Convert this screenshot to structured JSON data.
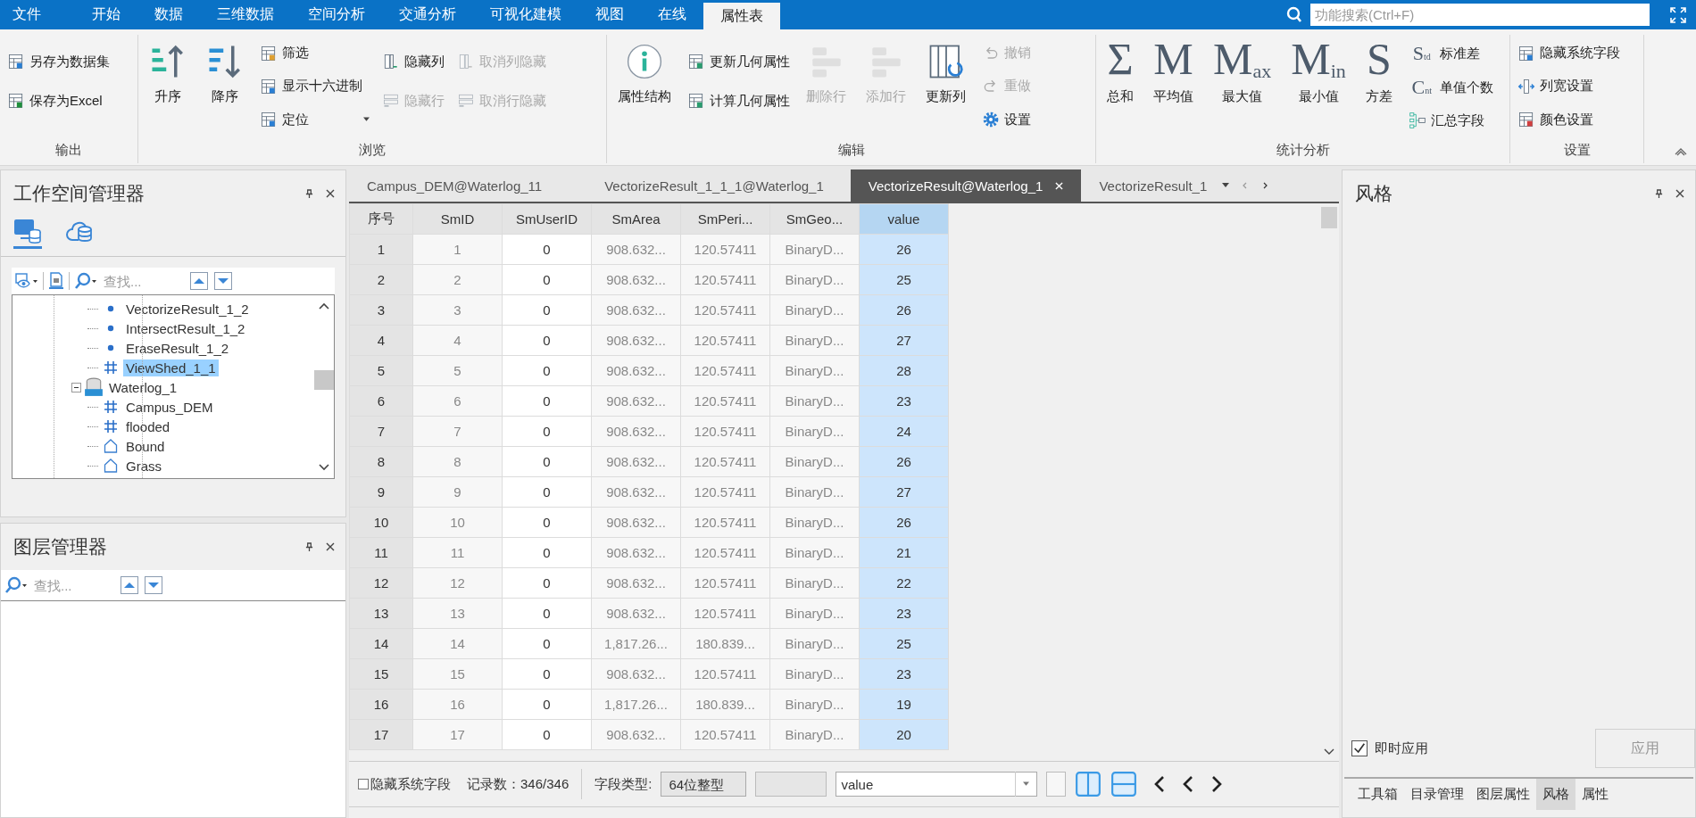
{
  "menu": {
    "tabs": [
      {
        "label": "文件",
        "selected": false
      },
      {
        "label": "开始",
        "selected": false
      },
      {
        "label": "数据",
        "selected": false
      },
      {
        "label": "三维数据",
        "selected": false
      },
      {
        "label": "空间分析",
        "selected": false
      },
      {
        "label": "交通分析",
        "selected": false
      },
      {
        "label": "可视化建模",
        "selected": false
      },
      {
        "label": "视图",
        "selected": false
      },
      {
        "label": "在线",
        "selected": false
      },
      {
        "label": "属性表",
        "selected": true
      }
    ],
    "search": {
      "placeholder": "功能搜索(Ctrl+F)"
    }
  },
  "ribbon": {
    "groups": [
      {
        "title": "输出",
        "columns": [
          [
            {
              "kind": "small",
              "label": "另存为数据集",
              "disabled": false
            },
            {
              "kind": "small",
              "label": "保存为Excel",
              "disabled": false
            }
          ]
        ]
      },
      {
        "title": "浏览",
        "columns": [
          [
            {
              "kind": "large",
              "label": "升序",
              "disabled": false
            }
          ],
          [
            {
              "kind": "large",
              "label": "降序",
              "disabled": false
            }
          ],
          [
            {
              "kind": "small",
              "label": "筛选",
              "disabled": false
            },
            {
              "kind": "small",
              "label": "显示十六进制",
              "disabled": false
            },
            {
              "kind": "small",
              "label": "定位",
              "disabled": false,
              "dropdown": true
            }
          ],
          [
            {
              "kind": "small",
              "label": "隐藏列",
              "disabled": false
            },
            {
              "kind": "small",
              "label": "隐藏行",
              "disabled": true
            }
          ],
          [
            {
              "kind": "small",
              "label": "取消列隐藏",
              "disabled": true
            },
            {
              "kind": "small",
              "label": "取消行隐藏",
              "disabled": true
            }
          ]
        ]
      },
      {
        "title": "编辑",
        "columns": [
          [
            {
              "kind": "large",
              "label": "属性结构",
              "disabled": false
            }
          ],
          [
            {
              "kind": "small",
              "label": "更新几何属性",
              "disabled": false
            },
            {
              "kind": "small",
              "label": "计算几何属性",
              "disabled": false
            }
          ],
          [
            {
              "kind": "large",
              "label": "删除行",
              "disabled": true
            }
          ],
          [
            {
              "kind": "large",
              "label": "添加行",
              "disabled": true
            }
          ],
          [
            {
              "kind": "large",
              "label": "更新列",
              "disabled": false
            }
          ],
          [
            {
              "kind": "small",
              "label": "撤销",
              "disabled": true
            },
            {
              "kind": "small",
              "label": "重做",
              "disabled": true
            },
            {
              "kind": "small",
              "label": "设置",
              "disabled": false
            }
          ]
        ]
      },
      {
        "title": "统计分析",
        "columns": [
          [
            {
              "kind": "large",
              "label": "总和",
              "glyph": "Σ",
              "disabled": false
            }
          ],
          [
            {
              "kind": "large",
              "label": "平均值",
              "glyph": "M",
              "disabled": false
            }
          ],
          [
            {
              "kind": "large",
              "label": "最大值",
              "glyph": "M",
              "glyph_sub": "ax",
              "disabled": false
            }
          ],
          [
            {
              "kind": "large",
              "label": "最小值",
              "glyph": "M",
              "glyph_sub": "in",
              "disabled": false
            }
          ],
          [
            {
              "kind": "large",
              "label": "方差",
              "glyph": "S",
              "disabled": false
            }
          ],
          [
            {
              "kind": "small",
              "label": "标准差",
              "glyph": "S",
              "glyph_sub": "td",
              "disabled": false
            },
            {
              "kind": "small",
              "label": "单值个数",
              "glyph": "C",
              "glyph_sub": "nt",
              "disabled": false
            },
            {
              "kind": "small",
              "label": "汇总字段",
              "disabled": false
            }
          ]
        ]
      },
      {
        "title": "设置",
        "columns": [
          [
            {
              "kind": "small",
              "label": "隐藏系统字段",
              "disabled": false
            },
            {
              "kind": "small",
              "label": "列宽设置",
              "disabled": false
            },
            {
              "kind": "small",
              "label": "颜色设置",
              "disabled": false
            }
          ]
        ]
      }
    ]
  },
  "workspace_panel": {
    "title": "工作空间管理器",
    "view_tabs": [
      {
        "selected": true
      },
      {
        "selected": false
      }
    ],
    "search": {
      "placeholder": "查找..."
    },
    "tree": [
      {
        "children": [
          {
            "label": "VectorizeResult_1_2",
            "kind": "point",
            "selected": false
          },
          {
            "label": "IntersectResult_1_2",
            "kind": "point",
            "selected": false
          },
          {
            "label": "EraseResult_1_2",
            "kind": "point",
            "selected": false
          },
          {
            "label": "ViewShed_1_1",
            "kind": "grid",
            "selected": true
          }
        ]
      },
      {
        "label": "Waterlog_1",
        "kind": "datasource",
        "expanded": true,
        "children": [
          {
            "label": "Campus_DEM",
            "kind": "grid",
            "selected": false
          },
          {
            "label": "flooded",
            "kind": "grid",
            "selected": false
          },
          {
            "label": "Bound",
            "kind": "region",
            "selected": false
          },
          {
            "label": "Grass",
            "kind": "region",
            "selected": false
          }
        ]
      }
    ]
  },
  "layer_panel": {
    "title": "图层管理器",
    "search": {
      "placeholder": "查找..."
    }
  },
  "document_tabs": [
    {
      "label": "Campus_DEM@Waterlog_11",
      "selected": false
    },
    {
      "label": "VectorizeResult_1_1_1@Waterlog_1",
      "selected": false
    },
    {
      "label": "VectorizeResult@Waterlog_1",
      "selected": true
    },
    {
      "label": "VectorizeResult_1",
      "selected": false
    }
  ],
  "table": {
    "columns": [
      {
        "label": "序号",
        "kind": "index",
        "selected": false,
        "readonly": true
      },
      {
        "label": "SmID",
        "kind": "field",
        "selected": false,
        "readonly": true
      },
      {
        "label": "SmUserID",
        "kind": "field",
        "selected": false,
        "readonly": false
      },
      {
        "label": "SmArea",
        "kind": "field",
        "selected": false,
        "readonly": true
      },
      {
        "label": "SmPeri...",
        "kind": "field",
        "selected": false,
        "readonly": true
      },
      {
        "label": "SmGeo...",
        "kind": "field",
        "selected": false,
        "readonly": true
      },
      {
        "label": "value",
        "kind": "field",
        "selected": true,
        "readonly": false
      }
    ],
    "rows": [
      [
        "1",
        "1",
        "0",
        "908.632...",
        "120.57411",
        "BinaryD...",
        "26"
      ],
      [
        "2",
        "2",
        "0",
        "908.632...",
        "120.57411",
        "BinaryD...",
        "25"
      ],
      [
        "3",
        "3",
        "0",
        "908.632...",
        "120.57411",
        "BinaryD...",
        "26"
      ],
      [
        "4",
        "4",
        "0",
        "908.632...",
        "120.57411",
        "BinaryD...",
        "27"
      ],
      [
        "5",
        "5",
        "0",
        "908.632...",
        "120.57411",
        "BinaryD...",
        "28"
      ],
      [
        "6",
        "6",
        "0",
        "908.632...",
        "120.57411",
        "BinaryD...",
        "23"
      ],
      [
        "7",
        "7",
        "0",
        "908.632...",
        "120.57411",
        "BinaryD...",
        "24"
      ],
      [
        "8",
        "8",
        "0",
        "908.632...",
        "120.57411",
        "BinaryD...",
        "26"
      ],
      [
        "9",
        "9",
        "0",
        "908.632...",
        "120.57411",
        "BinaryD...",
        "27"
      ],
      [
        "10",
        "10",
        "0",
        "908.632...",
        "120.57411",
        "BinaryD...",
        "26"
      ],
      [
        "11",
        "11",
        "0",
        "908.632...",
        "120.57411",
        "BinaryD...",
        "21"
      ],
      [
        "12",
        "12",
        "0",
        "908.632...",
        "120.57411",
        "BinaryD...",
        "22"
      ],
      [
        "13",
        "13",
        "0",
        "908.632...",
        "120.57411",
        "BinaryD...",
        "23"
      ],
      [
        "14",
        "14",
        "0",
        "1,817.26...",
        "180.839...",
        "BinaryD...",
        "25"
      ],
      [
        "15",
        "15",
        "0",
        "908.632...",
        "120.57411",
        "BinaryD...",
        "23"
      ],
      [
        "16",
        "16",
        "0",
        "1,817.26...",
        "180.839...",
        "BinaryD...",
        "19"
      ],
      [
        "17",
        "17",
        "0",
        "908.632...",
        "120.57411",
        "BinaryD...",
        "20"
      ]
    ]
  },
  "bottom_bar": {
    "hide_system_fields": {
      "label": "隐藏系统字段",
      "checked": false
    },
    "record_count": "记录数：346/346",
    "field_type_label": "字段类型:",
    "field_type": "64位整型",
    "field_select": "value"
  },
  "style_panel": {
    "title": "风格",
    "instant_apply": {
      "label": "即时应用",
      "checked": true
    },
    "apply_button": {
      "label": "应用",
      "disabled": true
    },
    "tabs": [
      {
        "label": "工具箱",
        "selected": false
      },
      {
        "label": "目录管理",
        "selected": false
      },
      {
        "label": "图层属性",
        "selected": false
      },
      {
        "label": "风格",
        "selected": true
      },
      {
        "label": "属性",
        "selected": false
      }
    ]
  }
}
